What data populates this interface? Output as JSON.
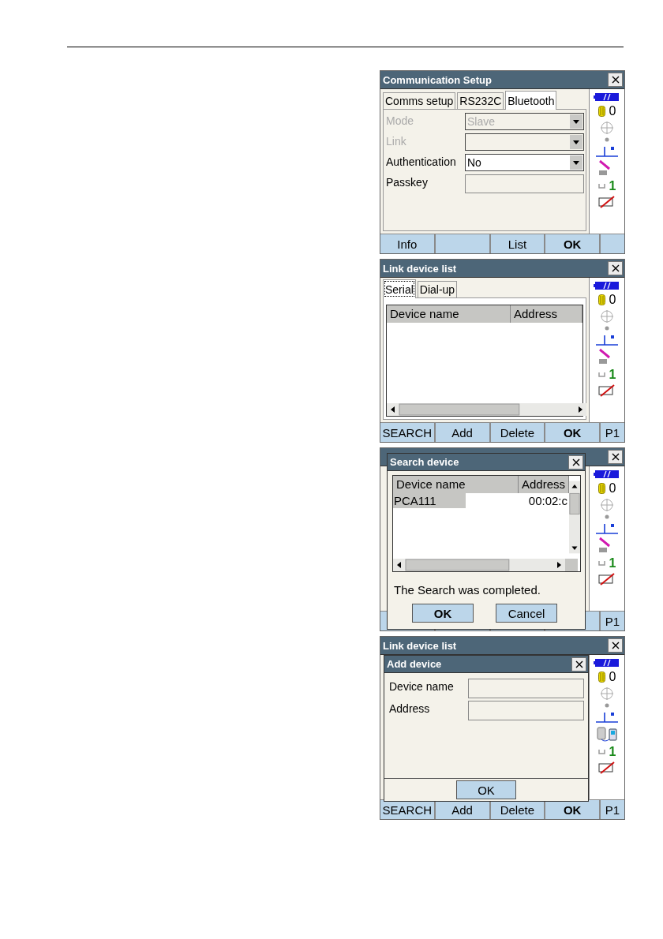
{
  "screens": [
    {
      "kind": "form",
      "title": "Communication Setup",
      "tabs": [
        {
          "label": "Comms setup",
          "selected": false
        },
        {
          "label": "RS232C",
          "selected": false
        },
        {
          "label": "Bluetooth",
          "selected": true
        }
      ],
      "fields": [
        {
          "label": "Mode",
          "kind": "dropdown",
          "value": "Slave",
          "disabled": true
        },
        {
          "label": "Link",
          "kind": "dropdown",
          "disabled": true
        },
        {
          "label": "Authentication",
          "kind": "dropdown",
          "value": "No",
          "disabled": false
        },
        {
          "label": "Passkey",
          "kind": "text",
          "disabled": false
        }
      ],
      "status": {
        "points": "0",
        "page": "1",
        "kind": "prism"
      },
      "softkeys": [
        {
          "kind": "key",
          "label": "Info"
        },
        {
          "kind": "blank"
        },
        {
          "kind": "key",
          "label": "List"
        },
        {
          "kind": "key",
          "label": "OK",
          "default": true
        },
        {
          "kind": "blank"
        }
      ]
    },
    {
      "kind": "list",
      "title": "Link device list",
      "tabs": [
        {
          "label": "Serial",
          "selected": true
        },
        {
          "label": "Dial-up",
          "selected": false
        }
      ],
      "table": {
        "columns": [
          "Device name",
          "Address"
        ]
      },
      "status": {
        "points": "0",
        "page": "1",
        "kind": "prism"
      },
      "softkeys": [
        {
          "kind": "key",
          "label": "SEARCH"
        },
        {
          "kind": "key",
          "label": "Add"
        },
        {
          "kind": "key",
          "label": "Delete"
        },
        {
          "kind": "key",
          "label": "OK",
          "default": true
        },
        {
          "kind": "key",
          "label": "P1"
        }
      ]
    },
    {
      "kind": "covered",
      "status": {
        "points": "0",
        "page": "1",
        "kind": "prism"
      },
      "softkeys": [
        {
          "kind": "blank"
        },
        {
          "kind": "blank"
        },
        {
          "kind": "blank"
        },
        {
          "kind": "blank"
        },
        {
          "kind": "key",
          "label": "P1"
        }
      ],
      "dialog": {
        "kind": "search",
        "title": "Search device",
        "columns": [
          "Device name",
          "Address"
        ],
        "rows": [
          {
            "cells": [
              "PCA111",
              "00:02:c"
            ],
            "selected": true
          }
        ],
        "message": "The Search was completed.",
        "buttons": [
          "OK",
          "Cancel"
        ]
      }
    },
    {
      "kind": "covered",
      "title": "Link device list",
      "status": {
        "points": "0",
        "page": "1",
        "kind": "link"
      },
      "softkeys": [
        {
          "kind": "key",
          "label": "SEARCH"
        },
        {
          "kind": "key",
          "label": "Add"
        },
        {
          "kind": "key",
          "label": "Delete"
        },
        {
          "kind": "key",
          "label": "OK",
          "default": true
        },
        {
          "kind": "key",
          "label": "P1"
        }
      ],
      "dialog": {
        "kind": "add",
        "title": "Add device",
        "fields": [
          {
            "label": "Device name"
          },
          {
            "label": "Address"
          }
        ],
        "buttons": [
          "OK"
        ]
      }
    }
  ]
}
